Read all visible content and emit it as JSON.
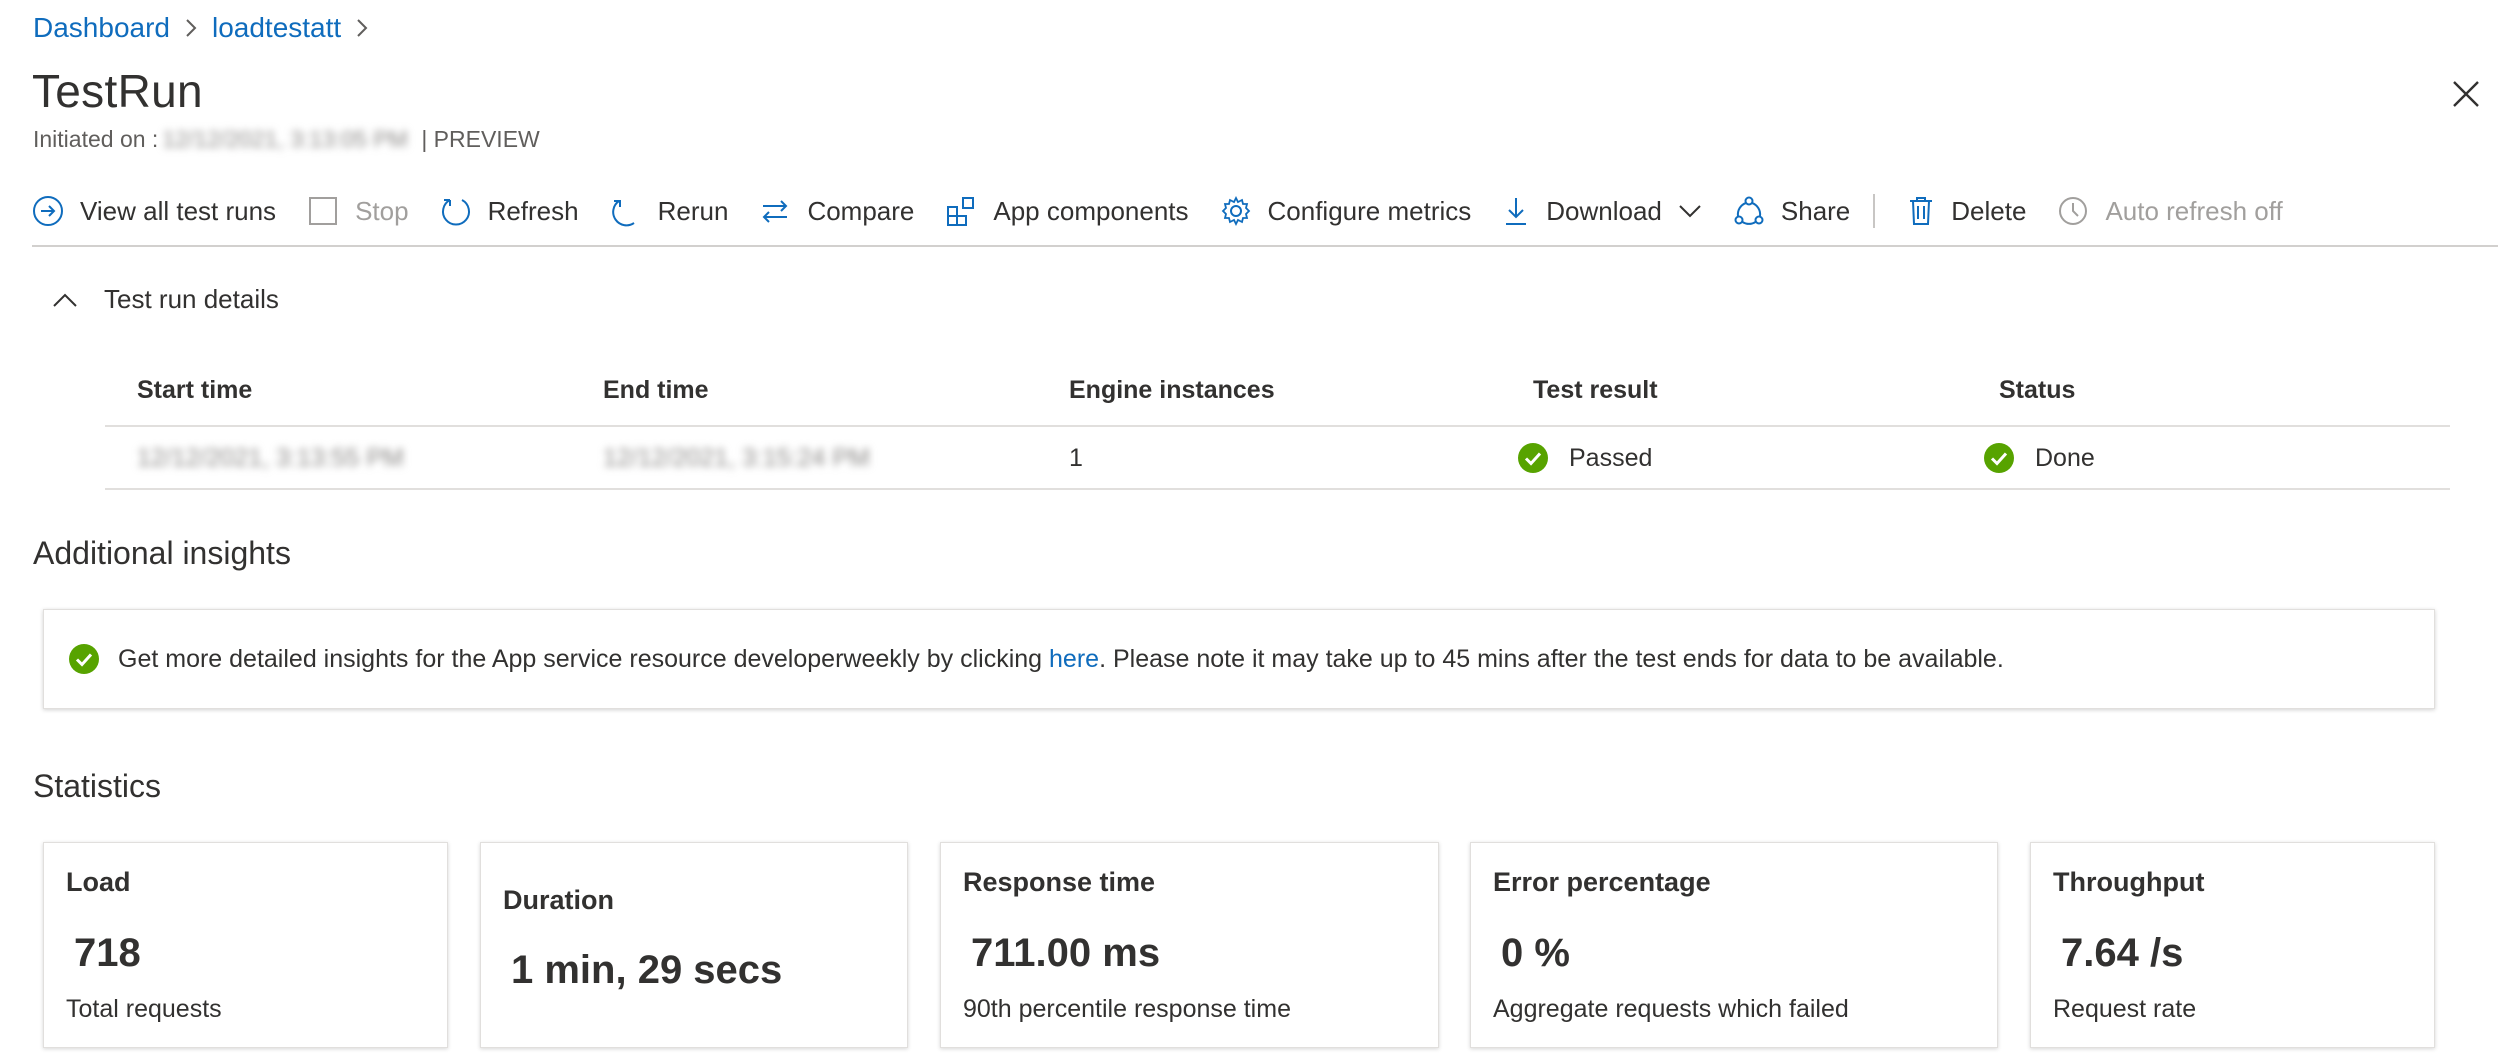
{
  "breadcrumb": {
    "items": [
      "Dashboard",
      "loadtestatt"
    ]
  },
  "page": {
    "title": "TestRun",
    "initiated_label": "Initiated on :",
    "initiated_value": "12/12/2021, 3:13:05 PM",
    "preview_label": "| PREVIEW"
  },
  "toolbar": {
    "view_all": "View all test runs",
    "stop": "Stop",
    "refresh": "Refresh",
    "rerun": "Rerun",
    "compare": "Compare",
    "app_components": "App components",
    "configure_metrics": "Configure metrics",
    "download": "Download",
    "share": "Share",
    "delete": "Delete",
    "auto_refresh": "Auto refresh off"
  },
  "details": {
    "toggle_label": "Test run details",
    "headers": [
      "Start time",
      "End time",
      "Engine instances",
      "Test result",
      "Status"
    ],
    "row": {
      "start_time": "12/12/2021, 3:13:55 PM",
      "end_time": "12/12/2021, 3:15:24 PM",
      "engine_instances": "1",
      "test_result": "Passed",
      "status": "Done"
    }
  },
  "insights": {
    "title": "Additional insights",
    "message_before": "Get more detailed insights for the App service resource developerweekly by clicking ",
    "link_text": "here",
    "message_after": ". Please note it may take up to 45 mins after the test ends for data to be available."
  },
  "statistics": {
    "title": "Statistics",
    "cards": [
      {
        "title": "Load",
        "value": "718",
        "desc": "Total requests"
      },
      {
        "title": "Duration",
        "value": "1 min, 29 secs",
        "desc": ""
      },
      {
        "title": "Response time",
        "value": "711.00 ms",
        "desc": "90th percentile response time"
      },
      {
        "title": "Error percentage",
        "value": "0 %",
        "desc": "Aggregate requests which failed"
      },
      {
        "title": "Throughput",
        "value": "7.64 /s",
        "desc": "Request rate"
      }
    ]
  },
  "colors": {
    "accent": "#0f6cbd",
    "success": "#57a300",
    "text": "#323130",
    "disabled": "#a19f9d"
  }
}
